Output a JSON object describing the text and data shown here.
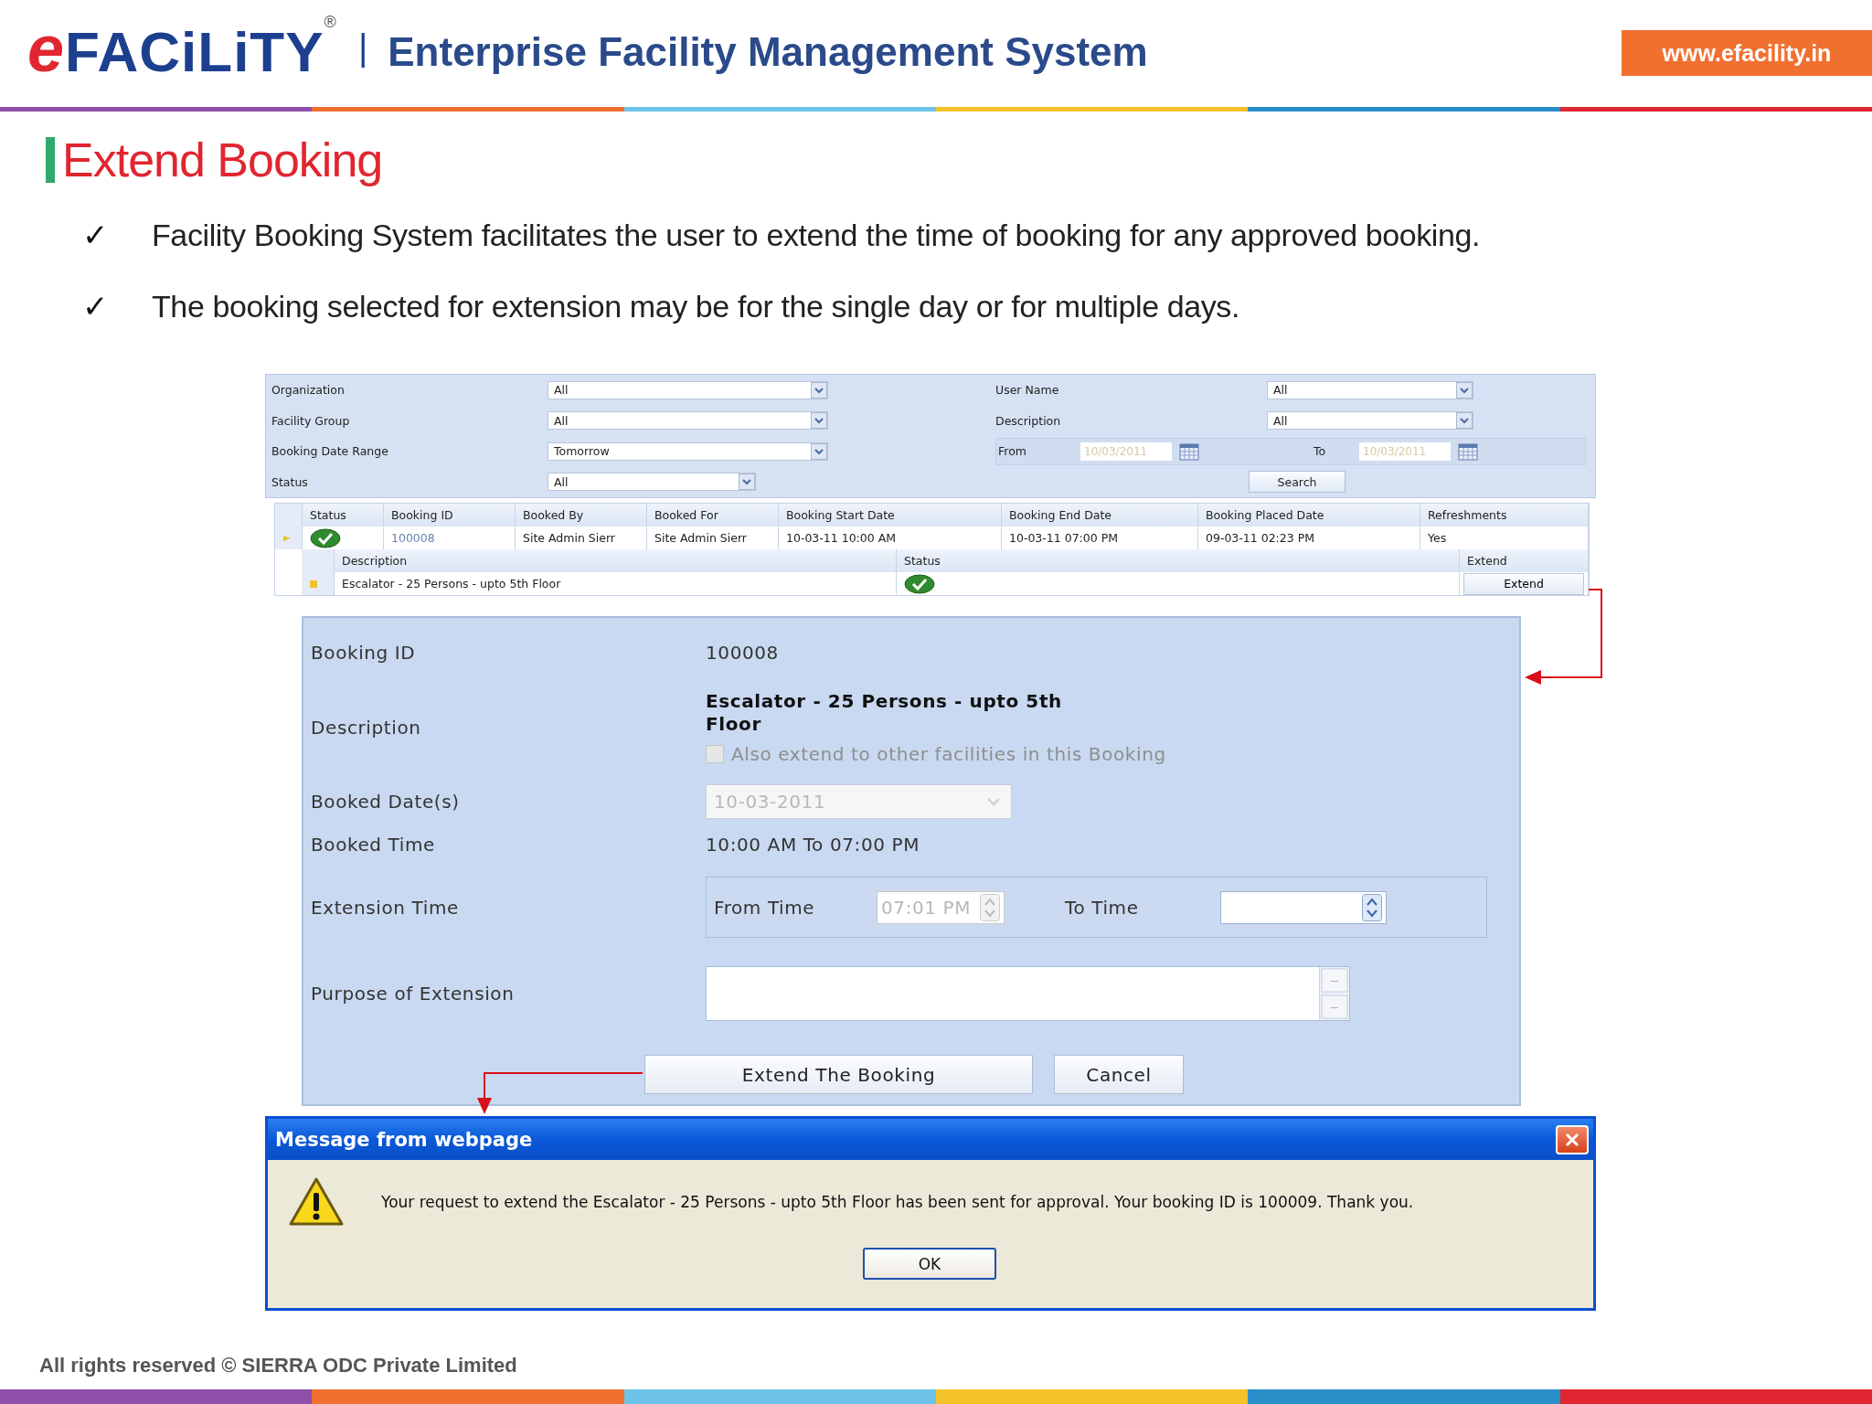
{
  "header": {
    "logo": "eFACiLiTY",
    "registered": "®",
    "separator": "|",
    "tagline": "Enterprise Facility Management System",
    "website": "www.efacility.in"
  },
  "slide_title": "Extend Booking",
  "bullets": [
    {
      "mark": "✓",
      "text": "Facility Booking System facilitates the user to extend the time of booking for any approved booking."
    },
    {
      "mark": "✓",
      "text": "The booking selected for extension may be for the single day or for multiple days."
    }
  ],
  "left_filters": [
    {
      "label": "Organization",
      "value": "All"
    },
    {
      "label": "Facility Group",
      "value": "All"
    },
    {
      "label": "Booking Date Range",
      "value": "Tomorrow"
    },
    {
      "label": "Status",
      "value": "All"
    }
  ],
  "right_filters": [
    {
      "label": "User Name",
      "value": "All"
    },
    {
      "label": "Description",
      "value": "All"
    }
  ],
  "date_range": {
    "from_label": "From",
    "from_value": "10/03/2011",
    "to_label": "To",
    "to_value": "10/03/2011"
  },
  "search_button": "Search",
  "bookings_table": {
    "status_column": "Status",
    "columns": [
      "Booking ID",
      "Booked By",
      "Booked For",
      "Booking Start Date",
      "Booking End Date",
      "Booking Placed Date",
      "Refreshments"
    ],
    "rows": [
      {
        "approved": true,
        "cells": [
          "100008",
          "Site Admin Sierr",
          "Site Admin Sierr",
          "10-03-11 10:00 AM",
          "10-03-11 07:00 PM",
          "09-03-11 02:23 PM",
          "Yes"
        ]
      }
    ],
    "detail_columns": [
      "Description",
      "Status",
      "Extend"
    ],
    "detail_rows": [
      {
        "description": "Escalator - 25 Persons - upto 5th Floor",
        "approved": true,
        "action": "Extend"
      }
    ]
  },
  "dialog": {
    "fields": [
      {
        "kind": "text",
        "label": "Booking ID",
        "value": "100008"
      },
      {
        "kind": "description",
        "label": "Description",
        "value": "Escalator - 25 Persons - upto 5th Floor",
        "option": {
          "label": "Also extend to other facilities in this Booking",
          "checked": false,
          "disabled": true
        }
      },
      {
        "kind": "select",
        "label": "Booked Date(s)",
        "value": "10-03-2011",
        "disabled": true
      },
      {
        "kind": "text",
        "label": "Booked Time",
        "value": "10:00 AM To 07:00 PM"
      },
      {
        "kind": "time_range",
        "label": "Extension Time",
        "from_label": "From Time",
        "from_value": "07:01 PM",
        "from_disabled": true,
        "to_label": "To Time"
      },
      {
        "kind": "textarea",
        "label": "Purpose of Extension"
      }
    ],
    "buttons": [
      "Extend The Booking",
      "Cancel"
    ]
  },
  "message": {
    "title": "Message from webpage",
    "text": "Your request to extend the Escalator - 25 Persons - upto 5th Floor has been sent for approval. Your booking ID is 100009. Thank you.",
    "button": "OK"
  },
  "footer": "All rights reserved © SIERRA ODC Private Limited"
}
